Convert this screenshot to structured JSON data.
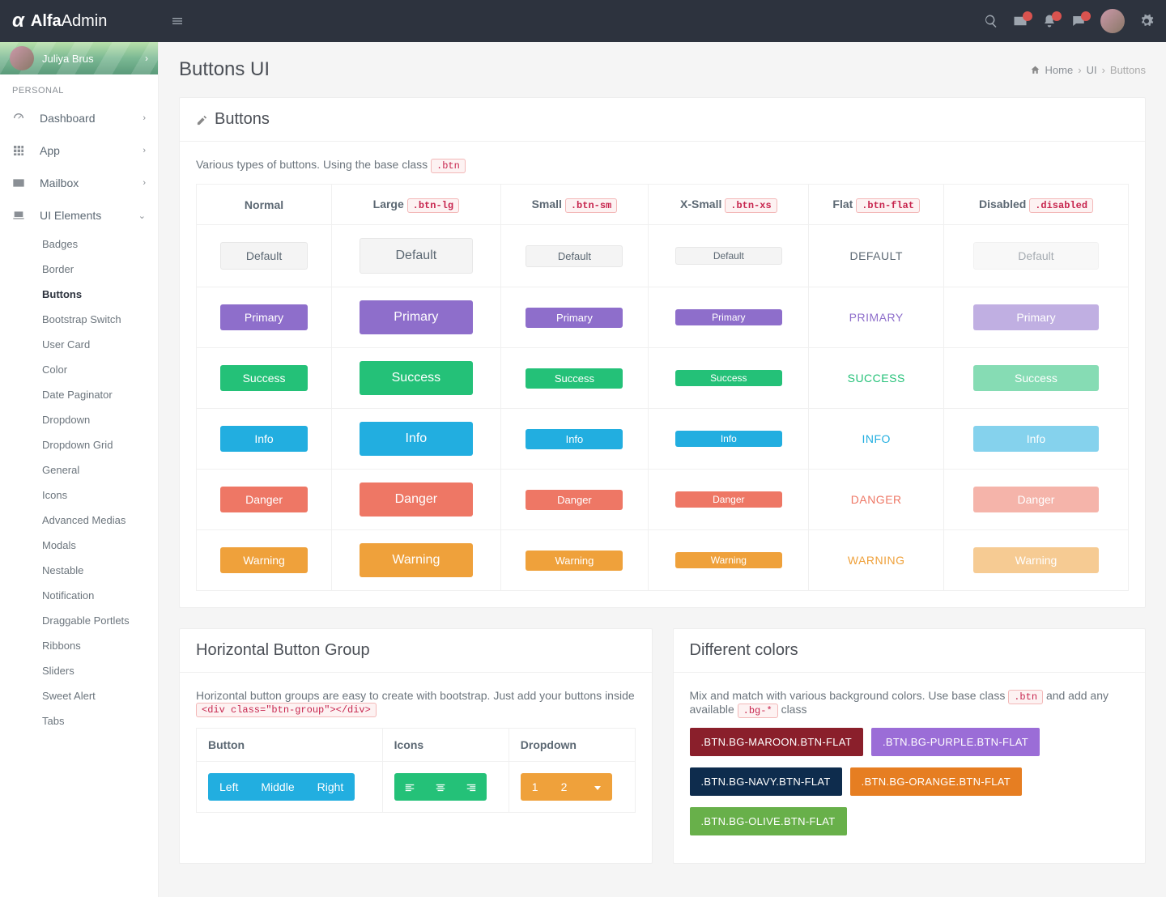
{
  "brand": {
    "bold": "Alfa",
    "light": "Admin"
  },
  "user": {
    "name": "Juliya Brus"
  },
  "sidebar": {
    "sectionLabel": "PERSONAL",
    "items": [
      {
        "label": "Dashboard"
      },
      {
        "label": "App"
      },
      {
        "label": "Mailbox"
      },
      {
        "label": "UI Elements"
      }
    ],
    "uiSub": [
      "Badges",
      "Border",
      "Buttons",
      "Bootstrap Switch",
      "User Card",
      "Color",
      "Date Paginator",
      "Dropdown",
      "Dropdown Grid",
      "General",
      "Icons",
      "Advanced Medias",
      "Modals",
      "Nestable",
      "Notification",
      "Draggable Portlets",
      "Ribbons",
      "Sliders",
      "Sweet Alert",
      "Tabs"
    ],
    "activeSub": "Buttons"
  },
  "page": {
    "title": "Buttons UI",
    "crumbs": [
      "Home",
      "UI",
      "Buttons"
    ]
  },
  "buttonsPanel": {
    "title": "Buttons",
    "intro": "Various types of buttons. Using the base class",
    "introCode": ".btn",
    "columns": [
      {
        "label": "Normal",
        "code": ""
      },
      {
        "label": "Large",
        "code": ".btn-lg"
      },
      {
        "label": "Small",
        "code": ".btn-sm"
      },
      {
        "label": "X-Small",
        "code": ".btn-xs"
      },
      {
        "label": "Flat",
        "code": ".btn-flat"
      },
      {
        "label": "Disabled",
        "code": ".disabled"
      }
    ],
    "rows": [
      {
        "label": "Default",
        "cls": "btn-default"
      },
      {
        "label": "Primary",
        "cls": "btn-primary"
      },
      {
        "label": "Success",
        "cls": "btn-success"
      },
      {
        "label": "Info",
        "cls": "btn-info"
      },
      {
        "label": "Danger",
        "cls": "btn-danger"
      },
      {
        "label": "Warning",
        "cls": "btn-warning"
      }
    ],
    "flatLabels": [
      "DEFAULT",
      "PRIMARY",
      "SUCCESS",
      "INFO",
      "DANGER",
      "WARNING"
    ]
  },
  "hgroup": {
    "title": "Horizontal Button Group",
    "intro1": "Horizontal button groups are easy to create with bootstrap. Just add your buttons inside",
    "code": "<div class=\"btn-group\"></div>",
    "headers": [
      "Button",
      "Icons",
      "Dropdown"
    ],
    "btns": [
      "Left",
      "Middle",
      "Right"
    ],
    "dropdown": [
      "1",
      "2"
    ]
  },
  "colorsPanel": {
    "title": "Different colors",
    "intro1": "Mix and match with various background colors. Use base class",
    "code1": ".btn",
    "intro2": "and add any available",
    "code2": ".bg-*",
    "intro3": "class",
    "buttons": [
      {
        "label": ".BTN.BG-MAROON.BTN-FLAT",
        "cls": "bg-maroon"
      },
      {
        "label": ".BTN.BG-PURPLE.BTN-FLAT",
        "cls": "bg-purple"
      },
      {
        "label": ".BTN.BG-NAVY.BTN-FLAT",
        "cls": "bg-navy"
      },
      {
        "label": ".BTN.BG-ORANGE.BTN-FLAT",
        "cls": "bg-orange2"
      },
      {
        "label": ".BTN.BG-OLIVE.BTN-FLAT",
        "cls": "bg-olive"
      }
    ]
  }
}
